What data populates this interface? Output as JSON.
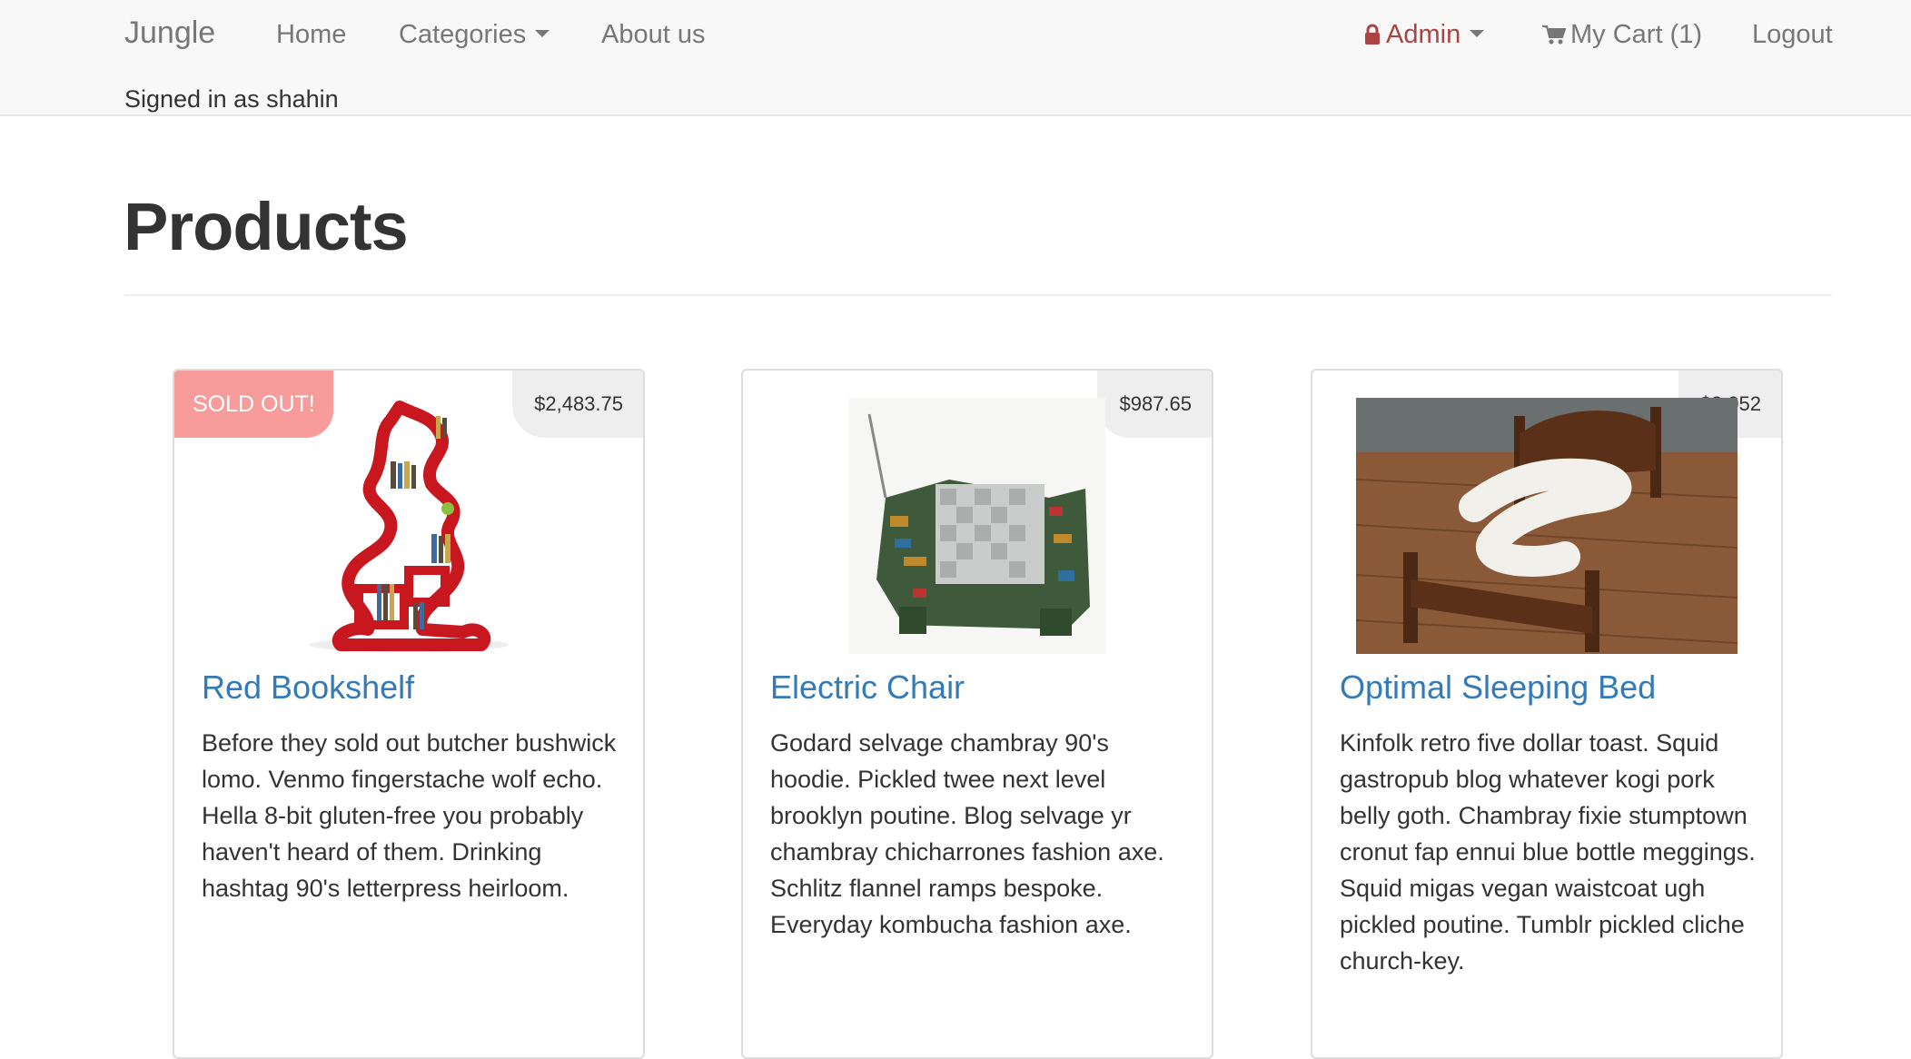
{
  "navbar": {
    "brand": "Jungle",
    "home": "Home",
    "categories": "Categories",
    "about": "About us",
    "admin": "Admin",
    "cart": "My Cart (1)",
    "logout": "Logout",
    "signed_in": "Signed in as shahin"
  },
  "page": {
    "title": "Products"
  },
  "products": [
    {
      "name": "Red Bookshelf",
      "price": "$2,483.75",
      "badge": "SOLD OUT!",
      "description": "Before they sold out butcher bushwick lomo. Venmo fingerstache wolf echo. Hella 8-bit gluten-free you probably haven't heard of them. Drinking hashtag 90's letterpress heirloom."
    },
    {
      "name": "Electric Chair",
      "price": "$987.65",
      "description": "Godard selvage chambray 90's hoodie. Pickled twee next level brooklyn poutine. Blog selvage yr chambray chicharrones fashion axe. Schlitz flannel ramps bespoke. Everyday kombucha fashion axe."
    },
    {
      "name": "Optimal Sleeping Bed",
      "price": "$3,052",
      "description": "Kinfolk retro five dollar toast. Squid gastropub blog whatever kogi pork belly goth. Chambray fixie stumptown cronut fap ennui blue bottle meggings. Squid migas vegan waistcoat ugh pickled poutine. Tumblr pickled cliche church-key."
    }
  ],
  "colors": {
    "link": "#337ab7",
    "admin": "#a94442",
    "sold_out": "#f89b9b"
  }
}
